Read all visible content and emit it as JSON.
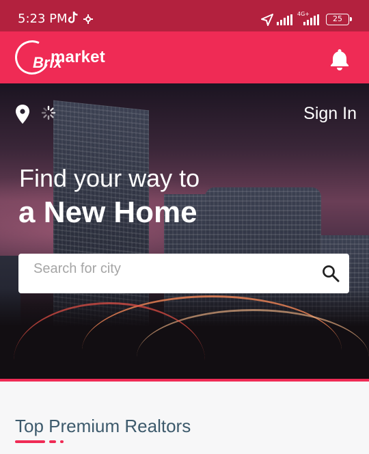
{
  "status_bar": {
    "time": "5:23 PM",
    "network_label": "4G+",
    "battery": "25",
    "icons": [
      "tiktok-icon",
      "gear-icon",
      "navigation-arrow-icon",
      "signal-icon",
      "signal-icon",
      "battery-icon"
    ]
  },
  "app_bar": {
    "logo_brix": "Brix",
    "logo_market": "market",
    "notification_icon": "bell-icon",
    "color": "#ef2b55"
  },
  "hero": {
    "sign_in": "Sign In",
    "line1": "Find your way to",
    "line2": "a New Home",
    "location_icon": "location-pin-icon",
    "loading_icon": "spinner-icon"
  },
  "search": {
    "placeholder": "Search for city",
    "value": "",
    "icon": "search-icon"
  },
  "section": {
    "title": "Top Premium Realtors"
  },
  "colors": {
    "accent": "#ef2b55",
    "status_bar": "#b3213e",
    "section_title": "#3d5a6c"
  }
}
